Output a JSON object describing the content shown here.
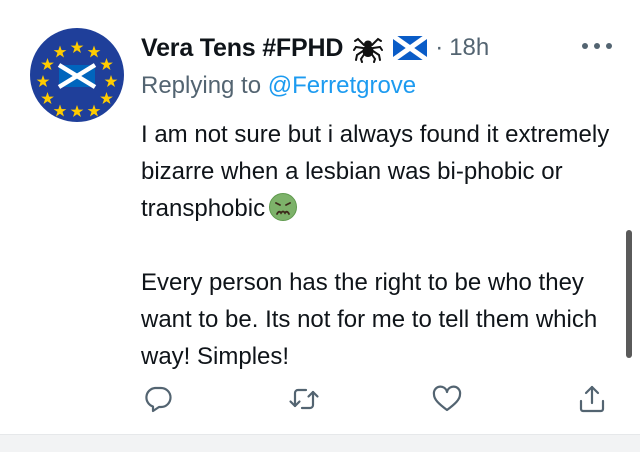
{
  "tweet": {
    "display_name": "Vera Tens #FPHD",
    "separator": "·",
    "timestamp": "18h",
    "replying_prefix": "Replying to ",
    "replying_handle": "@Ferretgrove",
    "paragraph1": "I am not sure but i always found it extremely bizarre when a lesbian was bi-phobic or transphobic",
    "paragraph2": "Every person has the right to be who they want to be. Its not for me to tell them which way! Simples!"
  },
  "icons": {
    "avatar": "eu-scotland-flag-avatar",
    "name_emoji_1": "spider-icon",
    "name_emoji_2": "scotland-flag-icon",
    "text_emoji": "nauseated-face-icon",
    "more": "more-icon",
    "actions": [
      "reply-icon",
      "retweet-icon",
      "like-icon",
      "share-icon"
    ]
  },
  "colors": {
    "text_primary": "#0f1419",
    "text_secondary": "#536471",
    "link": "#1d9bf0",
    "avatar_blue": "#1f3f9a",
    "eu_star_yellow": "#ffcc00",
    "nauseated_green": "#7db26a"
  }
}
